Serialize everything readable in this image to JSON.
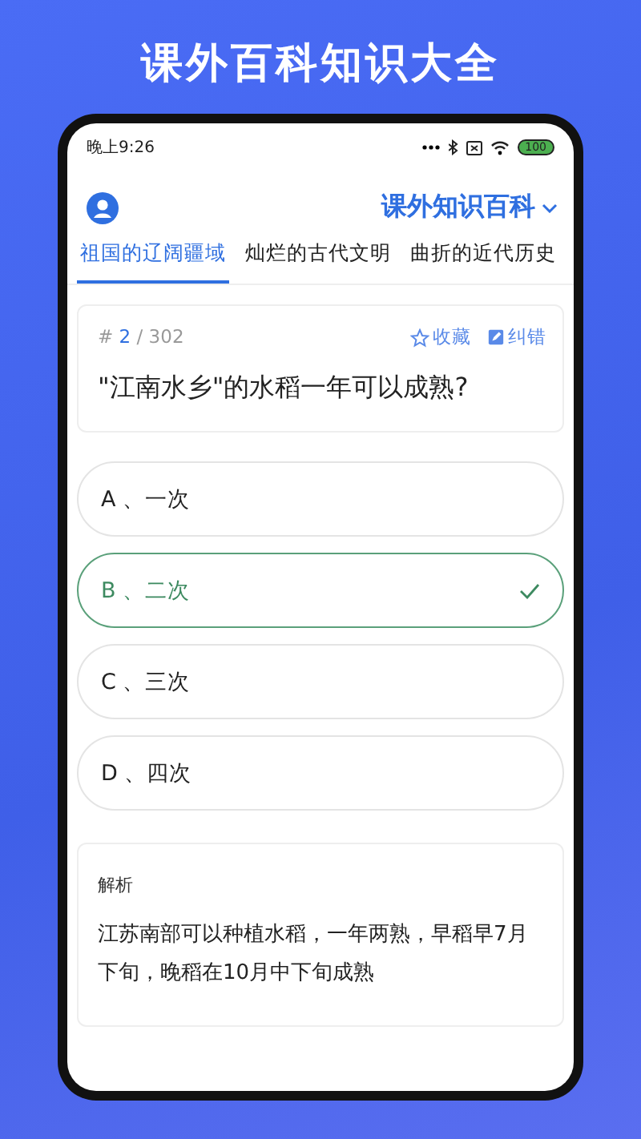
{
  "headline": "课外百科知识大全",
  "status_bar": {
    "time": "晚上9:26",
    "battery": "100"
  },
  "header": {
    "title": "课外知识百科"
  },
  "tabs": [
    {
      "label": "祖国的辽阔疆域",
      "selected": true
    },
    {
      "label": "灿烂的古代文明",
      "selected": false
    },
    {
      "label": "曲折的近代历史",
      "selected": false
    }
  ],
  "question": {
    "prefix": "#",
    "index": "2",
    "total": "/ 302",
    "actions": [
      {
        "kind": "star",
        "label": "收藏"
      },
      {
        "kind": "edit",
        "label": "纠错"
      }
    ],
    "text": "\"江南水乡\"的水稻一年可以成熟?"
  },
  "options": [
    {
      "label": "A 、一次",
      "selected": false
    },
    {
      "label": "B 、二次",
      "selected": true
    },
    {
      "label": "C 、三次",
      "selected": false
    },
    {
      "label": "D 、四次",
      "selected": false
    }
  ],
  "analysis": {
    "title": "解析",
    "text": "江苏南部可以种植水稻，一年两熟，早稻早7月下旬，晚稻在10月中下旬成熟"
  }
}
